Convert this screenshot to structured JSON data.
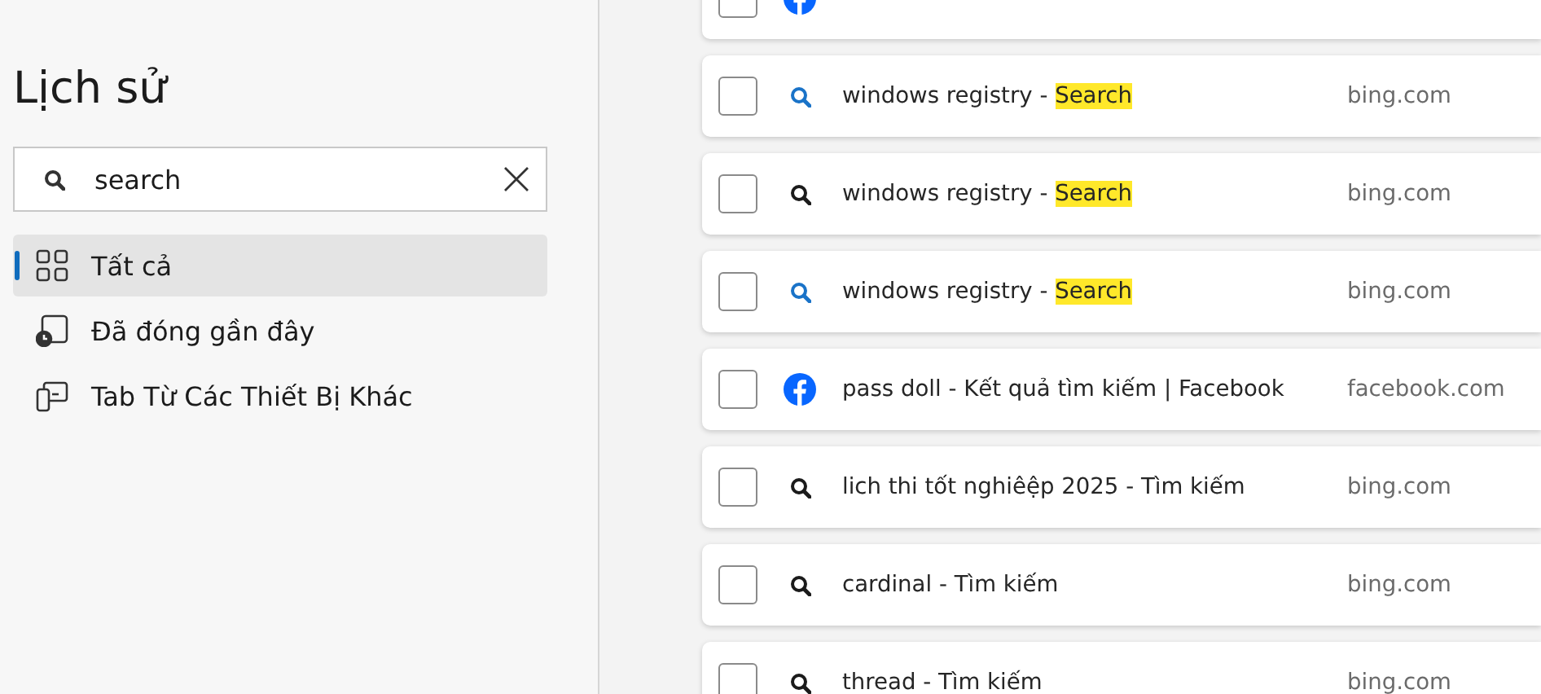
{
  "sidebar": {
    "title": "Lịch sử",
    "search": {
      "value": "search"
    },
    "items": [
      {
        "label": "Tất cả",
        "kind": "grid",
        "selected": true
      },
      {
        "label": "Đã đóng gần đây",
        "kind": "recent",
        "selected": false
      },
      {
        "label": "Tab Từ Các Thiết Bị Khác",
        "kind": "devices",
        "selected": false
      }
    ]
  },
  "history": [
    {
      "kind": "facebook",
      "checked": false
    },
    {
      "kind": "search",
      "color": "#1a73c8",
      "title": "windows registry -",
      "match": "Search",
      "domain": "bing.com",
      "checked": false
    },
    {
      "kind": "search",
      "color": "#1b1b1b",
      "title": "windows registry -",
      "match": "Search",
      "domain": "bing.com",
      "checked": false
    },
    {
      "kind": "search",
      "color": "#1a73c8",
      "title": "windows registry -",
      "match": "Search",
      "domain": "bing.com",
      "checked": false
    },
    {
      "kind": "facebook",
      "title": "pass doll - Kết quả tìm kiếm | Facebook",
      "domain": "facebook.com",
      "checked": false
    },
    {
      "kind": "search",
      "color": "#1b1b1b",
      "title": "lich thi tốt nghiêệp 2025 - Tìm kiếm",
      "domain": "bing.com",
      "checked": false
    },
    {
      "kind": "search",
      "color": "#1b1b1b",
      "title": "cardinal - Tìm kiếm",
      "domain": "bing.com",
      "checked": false
    },
    {
      "kind": "search",
      "color": "#1b1b1b",
      "title": "thread - Tìm kiếm",
      "domain": "bing.com",
      "checked": false
    }
  ]
}
